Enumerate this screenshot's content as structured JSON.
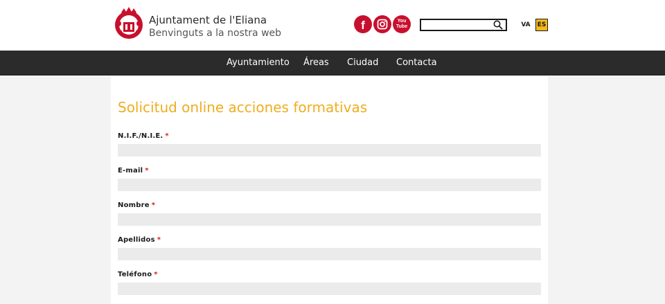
{
  "header": {
    "title": "Ajuntament de l'Eliana",
    "subtitle": "Benvinguts a la nostra web",
    "social": [
      "facebook",
      "instagram",
      "youtube"
    ],
    "youtube_text": [
      "You",
      "Tube"
    ],
    "search_value": "",
    "lang_va": "VA",
    "lang_es": "ES"
  },
  "nav": {
    "items": [
      "Ayuntamiento",
      "Áreas",
      "Ciudad",
      "Contacta"
    ]
  },
  "form": {
    "title": "Solicitud online acciones formativas",
    "required_mark": "*",
    "fields": [
      {
        "label": "N.I.F./N.I.E.",
        "value": ""
      },
      {
        "label": "E-mail",
        "value": ""
      },
      {
        "label": "Nombre",
        "value": ""
      },
      {
        "label": "Apellidos",
        "value": ""
      },
      {
        "label": "Teléfono",
        "value": ""
      }
    ]
  },
  "colors": {
    "accent": "#f0ad1e",
    "brand_red": "#c8102e",
    "nav_bg": "#2b2b2b",
    "required": "#d41c1c",
    "field_bg": "#ebebeb"
  }
}
